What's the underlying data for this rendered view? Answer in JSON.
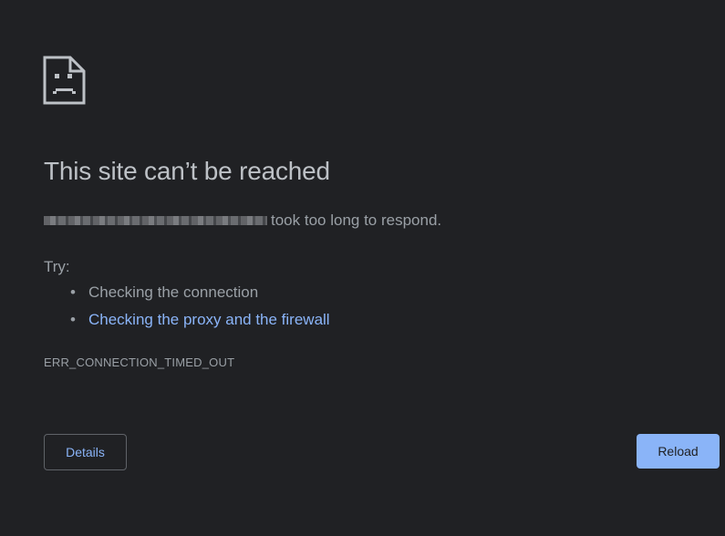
{
  "page": {
    "icon": "sad-page-icon",
    "title": "This site can’t be reached",
    "message_suffix": "took too long to respond.",
    "try_label": "Try:",
    "suggestions": [
      {
        "label": "Checking the connection",
        "is_link": false
      },
      {
        "label": "Checking the proxy and the firewall",
        "is_link": true
      }
    ],
    "error_code": "ERR_CONNECTION_TIMED_OUT"
  },
  "buttons": {
    "details_label": "Details",
    "reload_label": "Reload"
  },
  "colors": {
    "background": "#202124",
    "link": "#8ab4f8",
    "text": "#9aa0a6",
    "title": "#bdc1c6"
  }
}
